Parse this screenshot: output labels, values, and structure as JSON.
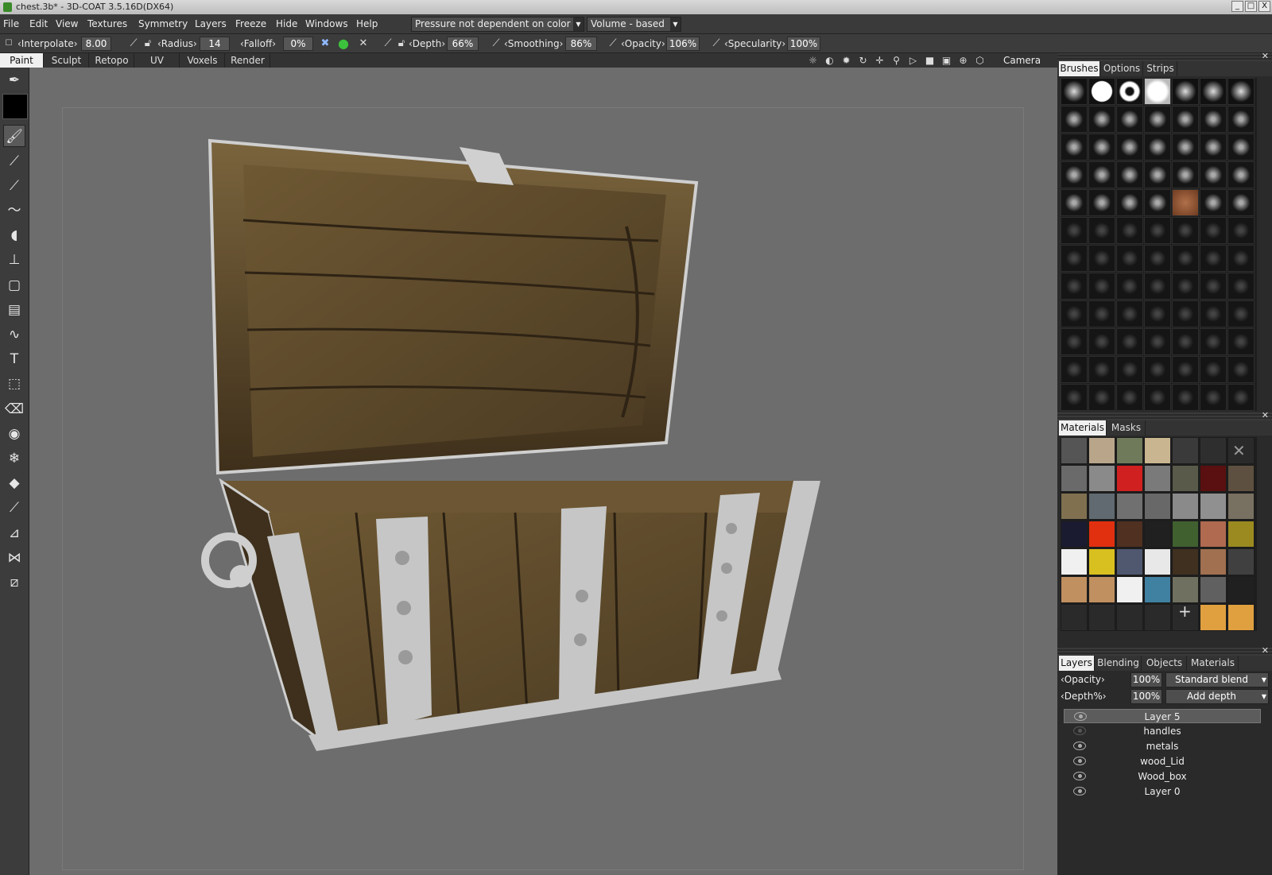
{
  "window": {
    "title": "chest.3b* - 3D-COAT 3.5.16D(DX64)",
    "buttons": [
      "_",
      "□",
      "X"
    ]
  },
  "menu": {
    "items": [
      "File",
      "Edit",
      "View",
      "Textures",
      "Symmetry",
      "Layers",
      "Freeze",
      "Hide",
      "Windows",
      "Help"
    ],
    "pressure_mode": "Pressure not dependent on color",
    "volume_mode": "Volume - based"
  },
  "toolbar": {
    "interpolate_label": "‹Interpolate›",
    "interpolate_value": "8.00",
    "radius_label": "‹Radius›",
    "radius_value": "14",
    "falloff_label": "‹Falloff›",
    "falloff_value": "0%",
    "depth_label": "‹Depth›",
    "depth_value": "66%",
    "smoothing_label": "‹Smoothing›",
    "smoothing_value": "86%",
    "opacity_label": "‹Opacity›",
    "opacity_value": "106%",
    "specularity_label": "‹Specularity›",
    "specularity_value": "100%"
  },
  "modes": {
    "tabs": [
      "Paint",
      "Sculpt",
      "Retopo",
      "UV",
      "Voxels",
      "Render"
    ],
    "active": "Paint",
    "camera_label": "Camera"
  },
  "brushes_panel": {
    "tabs": [
      "Brushes",
      "Options",
      "Strips"
    ],
    "active": "Brushes"
  },
  "materials_panel": {
    "tabs": [
      "Materials",
      "Masks"
    ],
    "active": "Materials",
    "add_symbol": "+",
    "remove_symbol": "✕"
  },
  "layers_panel": {
    "tabs": [
      "Layers",
      "Blending",
      "Objects",
      "Materials"
    ],
    "active": "Layers",
    "opacity_label": "‹Opacity›",
    "opacity_value": "100%",
    "blend_mode": "Standard blend",
    "depth_label": "‹Depth%›",
    "depth_value": "100%",
    "depth_mode": "Add depth",
    "layers": [
      {
        "name": "Layer 5",
        "visible": true,
        "active": true
      },
      {
        "name": "handles",
        "visible": false,
        "active": false
      },
      {
        "name": "metals",
        "visible": true,
        "active": false
      },
      {
        "name": "wood_Lid",
        "visible": true,
        "active": false
      },
      {
        "name": "Wood_box",
        "visible": true,
        "active": false
      },
      {
        "name": "Layer 0",
        "visible": true,
        "active": false
      }
    ]
  },
  "colors": {
    "wood": "#5e4a2c",
    "wood_dark": "#3d2f1c",
    "metal": "#c8c8c8",
    "viewport": "#6d6d6d"
  }
}
